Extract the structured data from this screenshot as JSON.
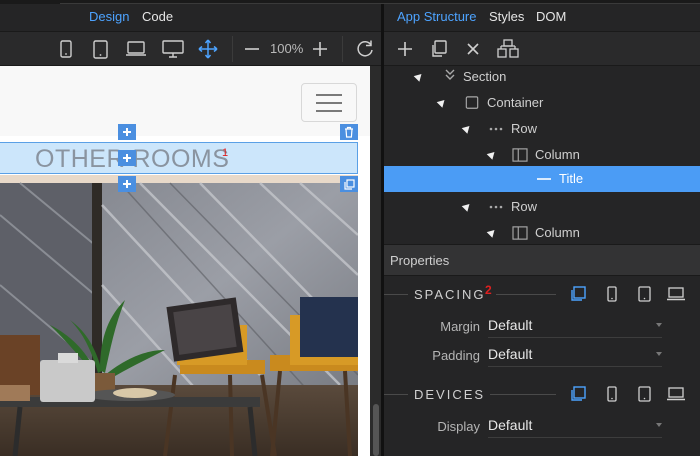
{
  "tabs_left": {
    "design": "Design",
    "code": "Code"
  },
  "tabs_right": {
    "app_structure": "App Structure",
    "styles": "Styles",
    "dom": "DOM"
  },
  "toolbar": {
    "zoom_value": "100%"
  },
  "canvas": {
    "title_text": "OTHER ROOMS",
    "title_badge": "1"
  },
  "tree": {
    "items": [
      {
        "label": "Section",
        "icon": "section-chevrons-icon"
      },
      {
        "label": "Container",
        "icon": "container-square-icon"
      },
      {
        "label": "Row",
        "icon": "row-dots-icon"
      },
      {
        "label": "Column",
        "icon": "column-icon"
      },
      {
        "label": "Title",
        "icon": "title-dash-icon",
        "selected": true
      },
      {
        "label": "Row",
        "icon": "row-dots-icon"
      },
      {
        "label": "Column",
        "icon": "column-icon"
      }
    ]
  },
  "properties": {
    "header": "Properties",
    "spacing": {
      "title": "SPACING",
      "badge": "2",
      "margin_label": "Margin",
      "margin_value": "Default",
      "padding_label": "Padding",
      "padding_value": "Default"
    },
    "devices": {
      "title": "DEVICES",
      "display_label": "Display",
      "display_value": "Default"
    }
  },
  "colors": {
    "accent": "#4da3ff",
    "selection": "#4b9cf5",
    "badge_red": "#e02020",
    "panel_bg": "#252526"
  }
}
